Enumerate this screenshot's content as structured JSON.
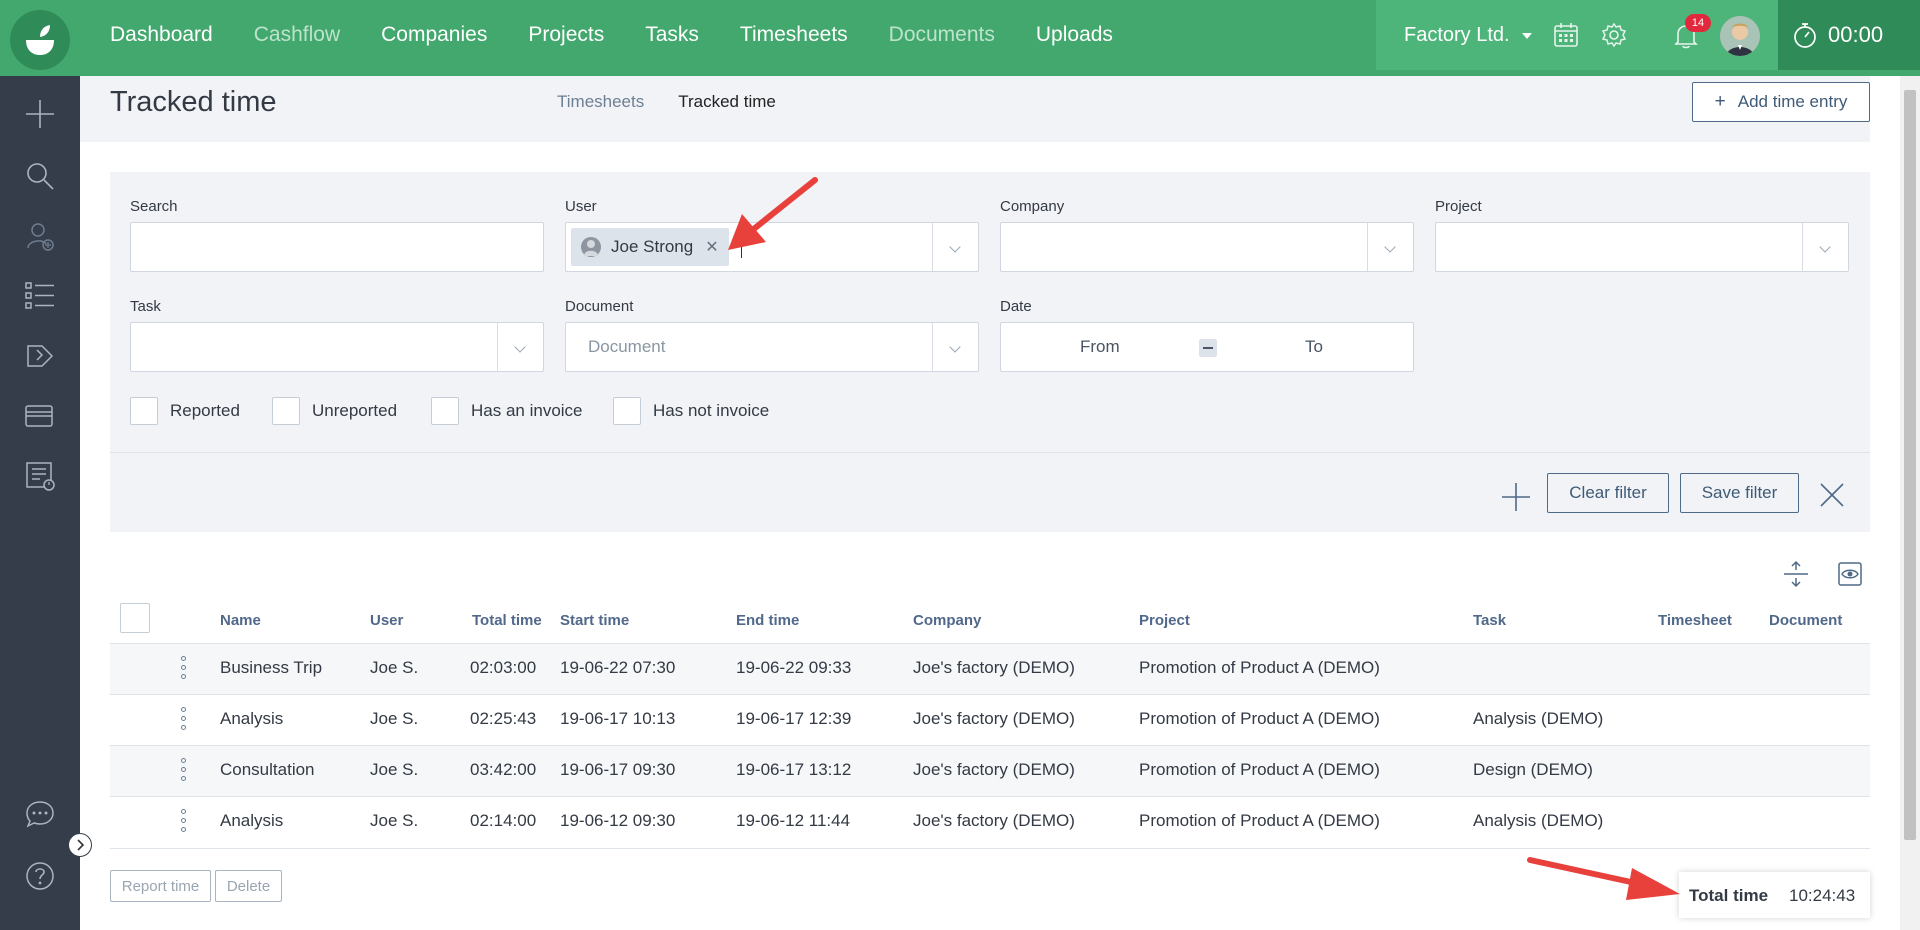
{
  "nav": {
    "items": [
      {
        "label": "Dashboard",
        "dim": false
      },
      {
        "label": "Cashflow",
        "dim": true
      },
      {
        "label": "Companies",
        "dim": false
      },
      {
        "label": "Projects",
        "dim": false
      },
      {
        "label": "Tasks",
        "dim": false
      },
      {
        "label": "Timesheets",
        "dim": false
      },
      {
        "label": "Documents",
        "dim": true
      },
      {
        "label": "Uploads",
        "dim": false
      }
    ],
    "company": "Factory Ltd.",
    "notification_count": "14",
    "timer": "00:00"
  },
  "page": {
    "title": "Tracked time",
    "subtabs": [
      {
        "label": "Timesheets",
        "active": false
      },
      {
        "label": "Tracked time",
        "active": true
      }
    ],
    "add_button": "Add time entry"
  },
  "filters": {
    "search_label": "Search",
    "user_label": "User",
    "user_chip": "Joe Strong",
    "company_label": "Company",
    "project_label": "Project",
    "task_label": "Task",
    "document_label": "Document",
    "document_placeholder": "Document",
    "date_label": "Date",
    "date_from": "From",
    "date_to": "To",
    "checkboxes": [
      "Reported",
      "Unreported",
      "Has an invoice",
      "Has not invoice"
    ],
    "clear_button": "Clear filter",
    "save_button": "Save filter"
  },
  "table": {
    "headers": [
      "Name",
      "User",
      "Total time",
      "Start time",
      "End time",
      "Company",
      "Project",
      "Task",
      "Timesheet",
      "Document"
    ],
    "rows": [
      {
        "name": "Business Trip",
        "user": "Joe S.",
        "total": "02:03:00",
        "start": "19-06-22 07:30",
        "end": "19-06-22 09:33",
        "company": "Joe's factory (DEMO)",
        "project": "Promotion of Product A (DEMO)",
        "task": "",
        "timesheet": "",
        "document": ""
      },
      {
        "name": "Analysis",
        "user": "Joe S.",
        "total": "02:25:43",
        "start": "19-06-17 10:13",
        "end": "19-06-17 12:39",
        "company": "Joe's factory (DEMO)",
        "project": "Promotion of Product A (DEMO)",
        "task": "Analysis (DEMO)",
        "timesheet": "",
        "document": ""
      },
      {
        "name": "Consultation",
        "user": "Joe S.",
        "total": "03:42:00",
        "start": "19-06-17 09:30",
        "end": "19-06-17 13:12",
        "company": "Joe's factory (DEMO)",
        "project": "Promotion of Product A (DEMO)",
        "task": "Design (DEMO)",
        "timesheet": "",
        "document": ""
      },
      {
        "name": "Analysis",
        "user": "Joe S.",
        "total": "02:14:00",
        "start": "19-06-12 09:30",
        "end": "19-06-12 11:44",
        "company": "Joe's factory (DEMO)",
        "project": "Promotion of Product A (DEMO)",
        "task": "Analysis (DEMO)",
        "timesheet": "",
        "document": ""
      }
    ],
    "report_button": "Report time",
    "delete_button": "Delete",
    "total_label": "Total time",
    "total_value": "10:24:43"
  },
  "colors": {
    "topbar": "#42a86e",
    "sidebar": "#353d4a",
    "annotation_arrow": "#e8413c"
  }
}
